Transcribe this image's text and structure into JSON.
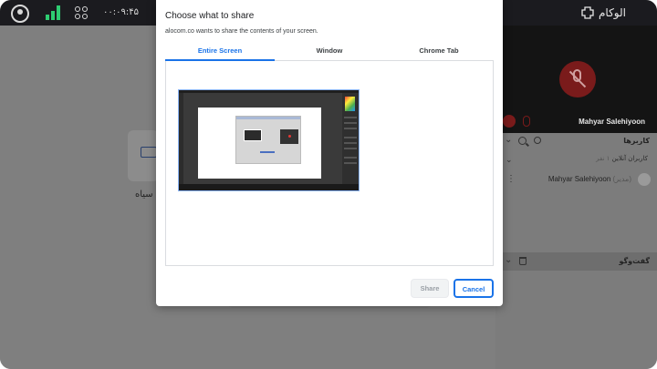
{
  "topbar": {
    "time": "۰۰:۰۹:۴۵",
    "logo_text": "الوکام"
  },
  "main": {
    "black_board_label": "ه سیاه"
  },
  "video": {
    "participant_name": "Mahyar Salehiyoon"
  },
  "users_panel": {
    "title": "کاربرها",
    "online_label": "کاربران آنلاین",
    "online_count": "۱ نفر",
    "member": {
      "name": "Mahyar Salehiyoon",
      "role": "(مدیر)"
    }
  },
  "chat_panel": {
    "title": "گفت‌وگو"
  },
  "dialog": {
    "title": "Choose what to share",
    "subtitle": "alocom.co wants to share the contents of your screen.",
    "tabs": [
      {
        "label": "Entire Screen",
        "active": true
      },
      {
        "label": "Window",
        "active": false
      },
      {
        "label": "Chrome Tab",
        "active": false
      }
    ],
    "share_label": "Share",
    "cancel_label": "Cancel"
  },
  "colors": {
    "accent": "#1a73e8",
    "signal": "#2ecc71",
    "muted_red": "#7a1b1b"
  }
}
